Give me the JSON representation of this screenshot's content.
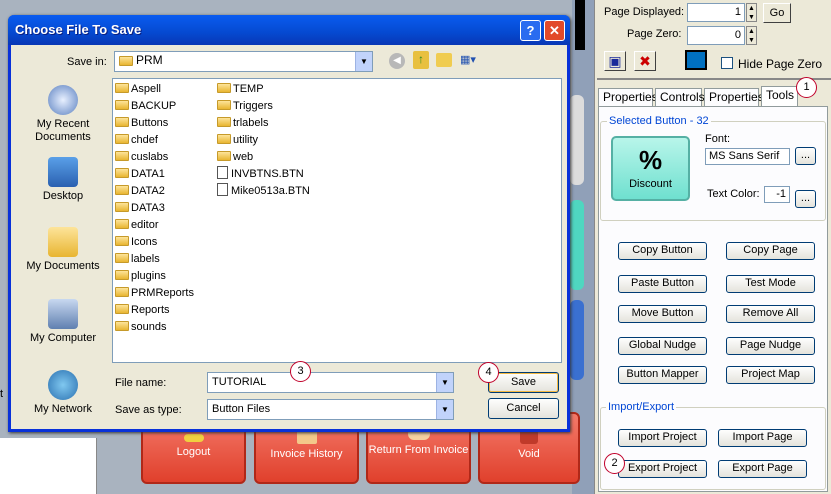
{
  "dialog": {
    "title": "Choose File To Save",
    "help": "?",
    "close": "✕",
    "save_in_label": "Save in:",
    "save_in_value": "PRM",
    "places": [
      "My Recent Documents",
      "Desktop",
      "My Documents",
      "My Computer",
      "My Network"
    ],
    "folders_col1": [
      "Aspell",
      "BACKUP",
      "Buttons",
      "chdef",
      "cuslabs",
      "DATA1",
      "DATA2",
      "DATA3",
      "editor",
      "Icons",
      "labels",
      "plugins",
      "PRMReports",
      "Reports",
      "sounds"
    ],
    "folders_col2": [
      "TEMP",
      "Triggers",
      "trlabels",
      "utility",
      "web"
    ],
    "files_col2": [
      "INVBTNS.BTN",
      "Mike0513a.BTN"
    ],
    "file_name_label": "File name:",
    "file_name_value": "TUTORIAL",
    "save_type_label": "Save as type:",
    "save_type_value": "Button Files",
    "save": "Save",
    "cancel": "Cancel"
  },
  "right_panel": {
    "page_displayed_label": "Page Displayed:",
    "page_displayed_value": "1",
    "go": "Go",
    "page_zero_label": "Page Zero:",
    "page_zero_value": "0",
    "hide_page_zero": "Hide Page Zero",
    "tabs": [
      "Properties",
      "Controls",
      "Properties",
      "Tools"
    ],
    "selected_button_label": "Selected Button - 32",
    "font_label": "Font:",
    "font_value": "MS Sans Serif",
    "ellipsis": "...",
    "text_color_label": "Text Color:",
    "text_color_value": "-1",
    "preview": {
      "symbol": "%",
      "caption": "Discount"
    },
    "tool_buttons": [
      "Copy Button",
      "Copy Page",
      "Paste Button",
      "Test Mode",
      "Move Button",
      "Remove All",
      "Global Nudge",
      "Page Nudge",
      "Button Mapper",
      "Project Map"
    ],
    "import_export_label": "Import/Export",
    "ie_buttons": [
      "Import Project",
      "Import Page",
      "Export Project",
      "Export Page"
    ]
  },
  "background": {
    "red_buttons": [
      "Logout",
      "Invoice History",
      "Return From Invoice",
      "Void"
    ],
    "left_edge_char": "t"
  },
  "annotations": [
    "1",
    "2",
    "3",
    "4"
  ]
}
